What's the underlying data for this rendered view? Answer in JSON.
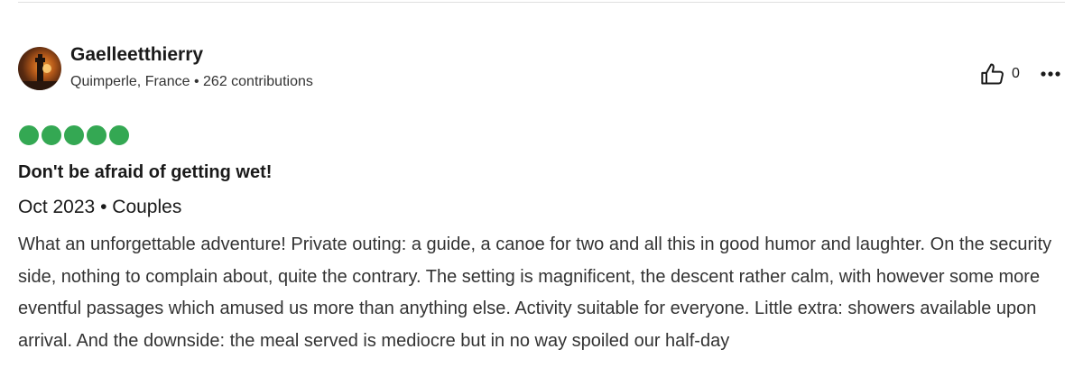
{
  "reviewer": {
    "name": "Gaelleetthierry",
    "location": "Quimperle, France",
    "separator": "•",
    "contributions": "262 contributions"
  },
  "actions": {
    "helpful_icon": "thumbs-up-icon",
    "helpful_count": "0",
    "more_icon": "more-options-icon"
  },
  "review": {
    "rating": 5,
    "rating_max": 5,
    "rating_color": "#34a853",
    "title": "Don't be afraid of getting wet!",
    "date": "Oct 2023",
    "trip_separator": "•",
    "trip_type": "Couples",
    "text": "What an unforgettable adventure! Private outing: a guide, a canoe for two and all this in good humor and laughter. On the security side, nothing to complain about, quite the contrary. The setting is magnificent, the descent rather calm, with however some more eventful passages which amused us more than anything else. Activity suitable for everyone. Little extra: showers available upon arrival. And the downside: the meal served is mediocre but in no way spoiled our half-day"
  }
}
